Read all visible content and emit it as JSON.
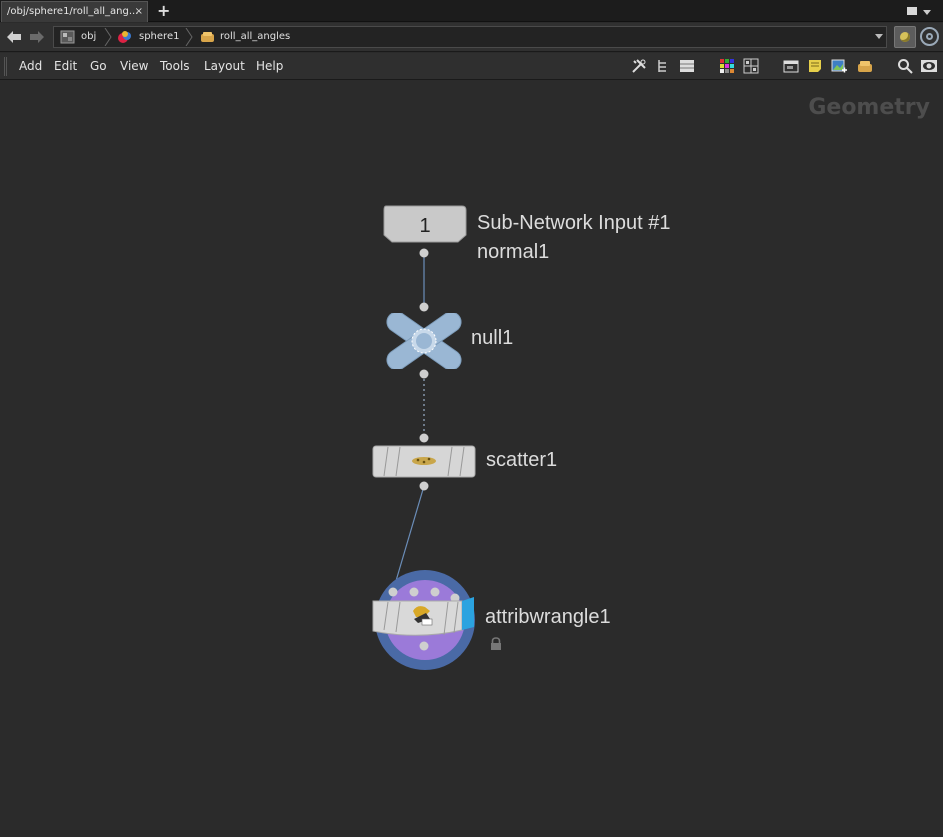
{
  "tabs": [
    {
      "label": "/obj/sphere1/roll_all_ang...",
      "close": "×"
    }
  ],
  "add_tab": "+",
  "path": [
    {
      "label": "obj",
      "icon": "obj-icon"
    },
    {
      "label": "sphere1",
      "icon": "sphere-icon"
    },
    {
      "label": "roll_all_angles",
      "icon": "subnet-icon"
    }
  ],
  "menu": [
    "Add",
    "Edit",
    "Go",
    "View",
    "Tools",
    "Layout",
    "Help"
  ],
  "toolbar_icons": [
    "tools-icon",
    "tree-icon",
    "list-icon",
    "color-palette-icon",
    "grid-icon",
    "network-box-icon",
    "sticky-note-icon",
    "background-image-icon",
    "subnet-box-icon",
    "search-icon",
    "eye-icon"
  ],
  "context_label": "Geometry",
  "nodes": {
    "subnet_input": {
      "number": "1",
      "label": "Sub-Network Input #1",
      "sublabel": "normal1"
    },
    "null1": {
      "label": "null1"
    },
    "scatter1": {
      "label": "scatter1"
    },
    "attribwrangle1": {
      "label": "attribwrangle1",
      "locked": true
    }
  },
  "colors": {
    "canvas": "#2b2b2b",
    "wire": "#6b8db8",
    "null_node": "#9ab7d4",
    "wrangle_ring": "#4a6aa6",
    "wrangle_inner": "#9b7ad9",
    "wrangle_flag": "#2ba3e0",
    "node_body": "#d9d9d9"
  }
}
